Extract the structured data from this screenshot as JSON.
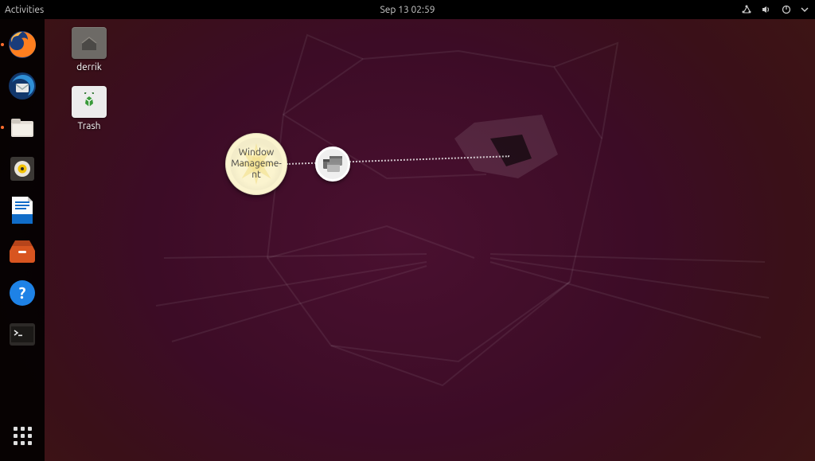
{
  "topbar": {
    "activities": "Activities",
    "clock": "Sep 13  02:59"
  },
  "dock": {
    "items": [
      {
        "name": "firefox",
        "active": true
      },
      {
        "name": "thunderbird",
        "active": false
      },
      {
        "name": "files",
        "active": true
      },
      {
        "name": "rhythmbox",
        "active": false
      },
      {
        "name": "libreoffice-writer",
        "active": false
      },
      {
        "name": "ubuntu-software",
        "active": false
      },
      {
        "name": "help",
        "active": false
      },
      {
        "name": "terminal",
        "active": false
      }
    ]
  },
  "desktop": {
    "home_label": "derrik",
    "trash_label": "Trash"
  },
  "pie": {
    "main_label": "Window Manageme-nt",
    "icon_name": "window-management-icon"
  }
}
